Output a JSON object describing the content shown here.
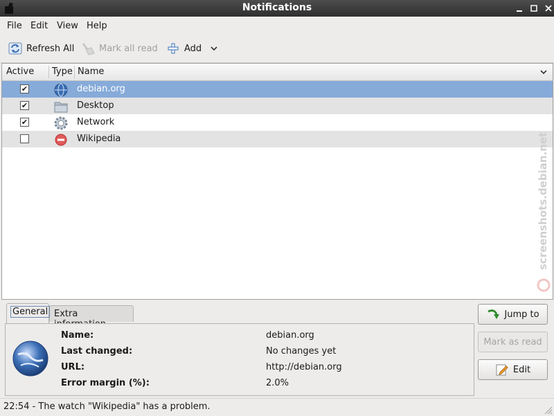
{
  "window": {
    "title": "Notifications"
  },
  "menu": {
    "file": "File",
    "edit": "Edit",
    "view": "View",
    "help": "Help"
  },
  "toolbar": {
    "refresh_all": "Refresh All",
    "mark_all_read": "Mark all read",
    "add": "Add"
  },
  "list": {
    "columns": [
      "Active",
      "Type",
      "Name"
    ],
    "rows": [
      {
        "name": "debian.org",
        "active": true,
        "type_icon": "globe-icon",
        "selected": true
      },
      {
        "name": "Desktop",
        "active": true,
        "type_icon": "folder-icon",
        "selected": false
      },
      {
        "name": "Network",
        "active": true,
        "type_icon": "gear-icon",
        "selected": false
      },
      {
        "name": "Wikipedia",
        "active": false,
        "type_icon": "error-icon",
        "selected": false
      }
    ]
  },
  "details": {
    "tabs": [
      "General",
      "Extra information"
    ],
    "active_tab": "General",
    "fields": [
      {
        "label": "Name:",
        "value": "debian.org"
      },
      {
        "label": "Last changed:",
        "value": "No changes yet"
      },
      {
        "label": "URL:",
        "value": "http://debian.org"
      },
      {
        "label": "Error margin (%):",
        "value": "2.0%"
      }
    ]
  },
  "buttons": {
    "jump_to": "Jump to",
    "mark_as_read": "Mark as read",
    "edit": "Edit"
  },
  "status": {
    "message": "22:54 - The watch \"Wikipedia\" has a problem."
  },
  "watermark": {
    "text": "screenshots.debian.net"
  },
  "colors": {
    "selection": "#86abd9",
    "titlebar": "#3a3a3a",
    "accent": "#3b6fb6"
  }
}
